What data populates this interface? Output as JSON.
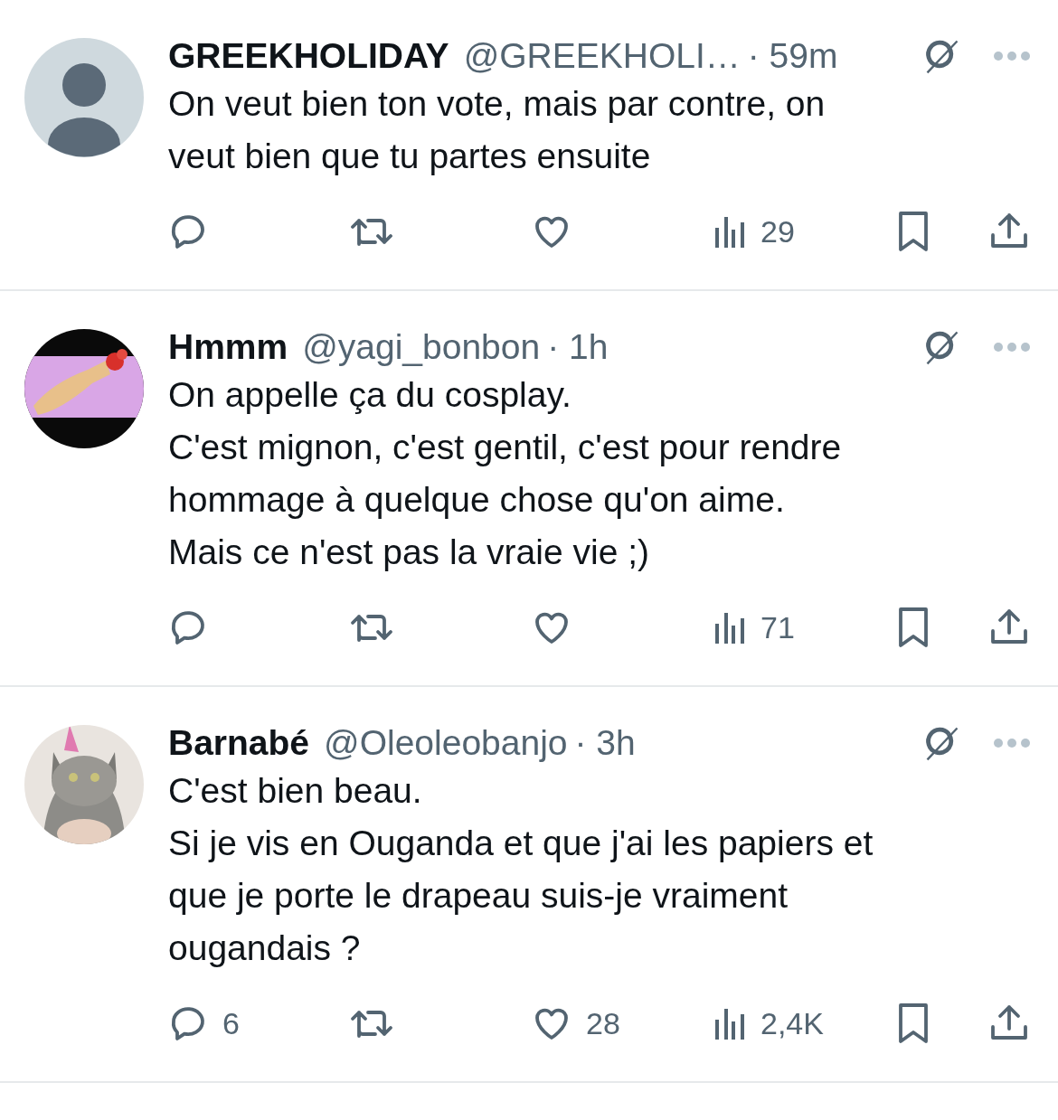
{
  "tweets": [
    {
      "avatar": {
        "kind": "default"
      },
      "name": "GREEKHOLIDAY",
      "handle": "@GREEKHOLI…",
      "time": "· 59m",
      "lines": [
        "On veut bien ton vote, mais par contre, on",
        "veut bien que tu partes ensuite"
      ],
      "counts": {
        "views": "29"
      }
    },
    {
      "name": "Hmmm",
      "handle": "@yagi_bonbon",
      "time": "· 1h",
      "lines": [
        "On appelle ça du cosplay.",
        "C'est mignon, c'est gentil, c'est pour rendre",
        "hommage à quelque chose qu'on aime.",
        "Mais ce n'est pas la vraie vie ;)"
      ],
      "counts": {
        "views": "71"
      }
    },
    {
      "name": "Barnabé",
      "handle": "@Oleoleobanjo",
      "time": "· 3h",
      "lines": [
        "C'est bien beau.",
        "Si je vis en Ouganda et que j'ai les papiers et",
        "que je porte le drapeau suis-je vraiment",
        "ougandais ?"
      ],
      "counts": {
        "reply": "6",
        "like": "28",
        "views": "2,4K"
      }
    }
  ]
}
